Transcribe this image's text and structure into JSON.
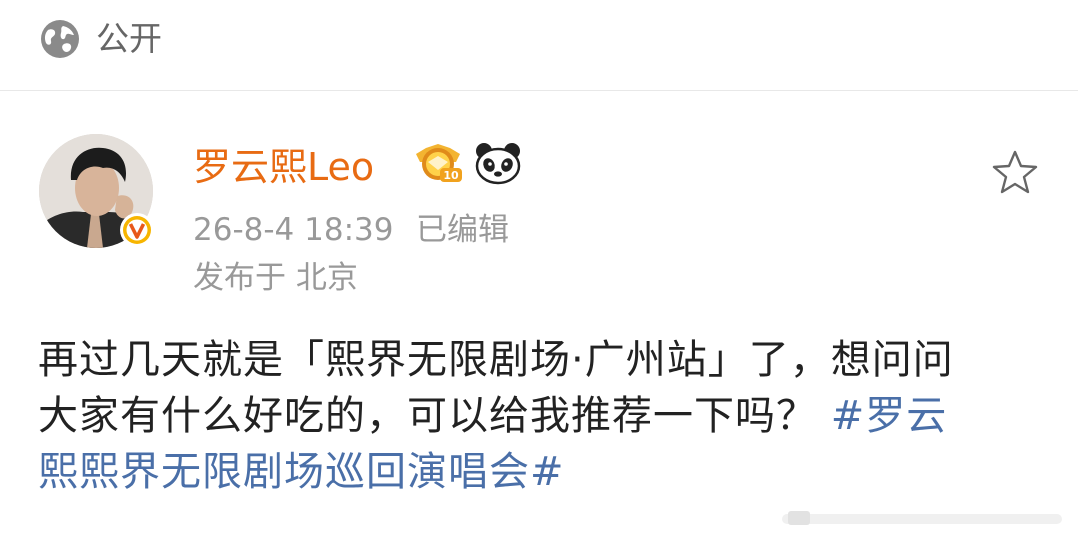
{
  "visibility": {
    "label": "公开",
    "icon": "globe-icon"
  },
  "post": {
    "author": {
      "name": "罗云熙Leo",
      "avatar": "avatar",
      "verified_icon": "verified-v-badge-icon",
      "rank_icon": "rank-10-badge-icon",
      "extra_icon": "panda-icon"
    },
    "time": "26-8-4 18:39",
    "edited": "已编辑",
    "location": "发布于 北京",
    "text": {
      "line1": "再过几天就是「熙界无限剧场·广州站」了，想问问",
      "line2_plain": "大家有什么好吃的，可以给我推荐一下吗？ ",
      "line2_tag": "#罗云",
      "line3_tag": "熙熙界无限剧场巡回演唱会#"
    },
    "favorite_icon": "star-icon"
  },
  "colors": {
    "username": "#e86b13",
    "hashtag": "#4a6fa8",
    "meta": "#999999"
  }
}
